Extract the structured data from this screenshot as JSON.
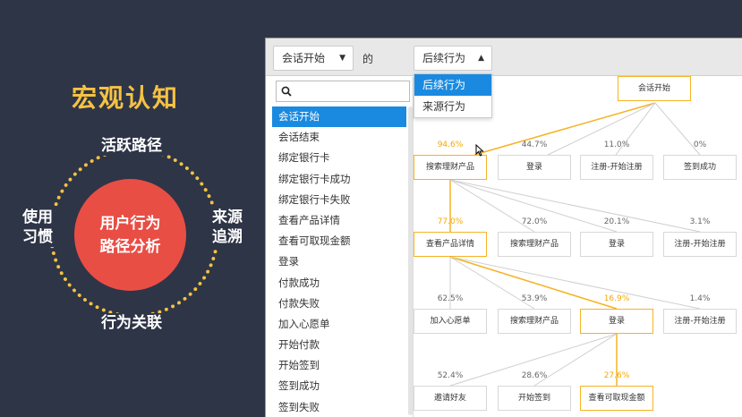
{
  "slide": {
    "title": "宏观认知",
    "center": [
      "用户行为",
      "路径分析"
    ],
    "ring_labels": {
      "top": "活跃路径",
      "bottom": "行为关联",
      "left": "使用\n习惯",
      "right": "来源\n追溯"
    }
  },
  "toolbar": {
    "event_select": "会话开始",
    "of_text": "的",
    "direction_select": "后续行为",
    "direction_options": [
      "后续行为",
      "来源行为"
    ]
  },
  "event_list": {
    "search_placeholder": "",
    "items": [
      "会话开始",
      "会话结束",
      "绑定银行卡",
      "绑定银行卡成功",
      "绑定银行卡失败",
      "查看产品详情",
      "查看可取现金额",
      "登录",
      "付款成功",
      "付款失败",
      "加入心愿单",
      "开始付款",
      "开始签到",
      "签到成功",
      "签到失败"
    ],
    "selected_index": 0
  },
  "tree": {
    "root": "会话开始",
    "level1": [
      {
        "pct": "94.6%",
        "label": "搜索理财产品"
      },
      {
        "pct": "44.7%",
        "label": "登录"
      },
      {
        "pct": "11.0%",
        "label": "注册-开始注册"
      },
      {
        "pct": "0%",
        "label": "签到成功"
      }
    ],
    "level2": [
      {
        "pct": "77.0%",
        "label": "查看产品详情"
      },
      {
        "pct": "72.0%",
        "label": "搜索理财产品"
      },
      {
        "pct": "20.1%",
        "label": "登录"
      },
      {
        "pct": "3.1%",
        "label": "注册-开始注册"
      }
    ],
    "level3": [
      {
        "pct": "62.5%",
        "label": "加入心愿单"
      },
      {
        "pct": "53.9%",
        "label": "搜索理财产品"
      },
      {
        "pct": "16.9%",
        "label": "登录"
      },
      {
        "pct": "1.4%",
        "label": "注册-开始注册"
      }
    ],
    "level4": [
      {
        "pct": "52.4%",
        "label": "邀请好友"
      },
      {
        "pct": "28.6%",
        "label": "开始签到"
      },
      {
        "pct": "27.6%",
        "label": "查看可取现金额"
      }
    ]
  },
  "colors": {
    "accent": "#f5c242",
    "circle": "#e94e45",
    "select_blue": "#1a8ae0",
    "path_highlight": "#f5b324"
  }
}
